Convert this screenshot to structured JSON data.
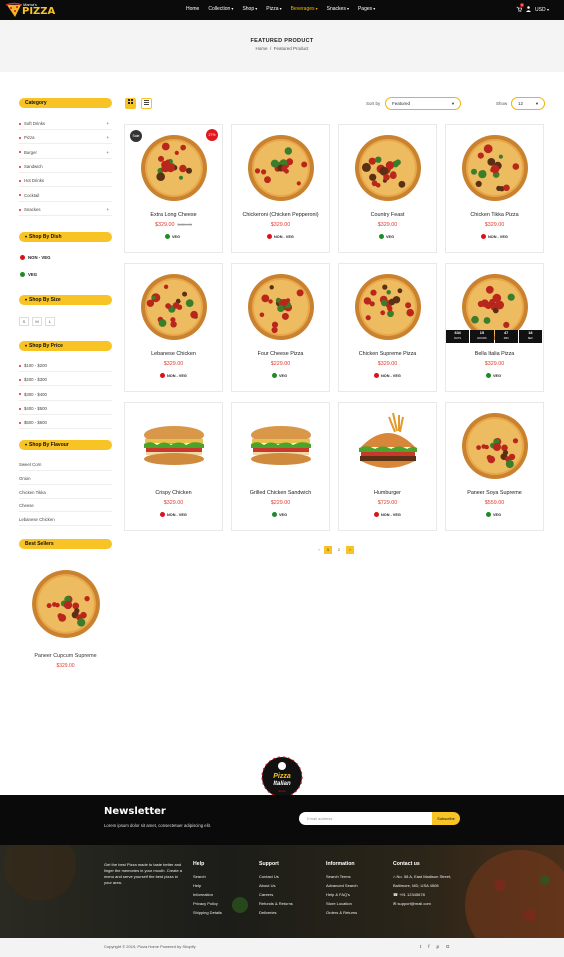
{
  "header": {
    "logo_top": "Mama's",
    "logo_main": "PIZZA",
    "nav": [
      {
        "label": "Home",
        "dd": false,
        "active": false
      },
      {
        "label": "Collection",
        "dd": true,
        "active": false
      },
      {
        "label": "Shop",
        "dd": true,
        "active": false
      },
      {
        "label": "Pizza",
        "dd": true,
        "active": false
      },
      {
        "label": "Beverages",
        "dd": true,
        "active": true
      },
      {
        "label": "Snackes",
        "dd": true,
        "active": false
      },
      {
        "label": "Pages",
        "dd": true,
        "active": false
      }
    ],
    "currency": "USD",
    "cart_count": "0"
  },
  "banner": {
    "title": "FEATURED PRODUCT",
    "crumb_home": "Home",
    "crumb_sep": "/",
    "crumb_current": "Featured Product"
  },
  "sidebar": {
    "category_title": "Category",
    "categories": [
      {
        "label": "Soft Drinks",
        "plus": true
      },
      {
        "label": "Pizza",
        "plus": true
      },
      {
        "label": "Burger",
        "plus": true
      },
      {
        "label": "Sandwich",
        "plus": false
      },
      {
        "label": "Hot Drinks",
        "plus": false
      },
      {
        "label": "Cocktail",
        "plus": false
      },
      {
        "label": "Snackes",
        "plus": true
      }
    ],
    "plus_symbol": "+",
    "dish_title": "Shop By Dish",
    "dish": [
      "NON - VEG",
      "VEG"
    ],
    "size_title": "Shop By Size",
    "sizes": [
      "S",
      "M",
      "L"
    ],
    "price_title": "Shop By Price",
    "prices": [
      "$100 - $200",
      "$200 - $300",
      "$300 - $400",
      "$400 - $500",
      "$500 - $600"
    ],
    "flavour_title": "Shop By Flavour",
    "flavours": [
      "Sweet Corn",
      "Onion",
      "Chicken Tikka",
      "Cheese",
      "Lebanese Chicken"
    ],
    "best_title": "Best Sellers",
    "best": {
      "name": "Paneer Cupcum Supreme",
      "price": "$329.00"
    }
  },
  "toolbar": {
    "sort_label": "Sort by",
    "sort_value": "Featured",
    "show_label": "Show",
    "show_value": "12"
  },
  "products": [
    {
      "name": "Extra Long Cheese",
      "price": "$329.00",
      "old": "$450.00",
      "tag": "VEG",
      "veg": true,
      "sale": "Sale",
      "pct": "27%",
      "kind": "pizza"
    },
    {
      "name": "Chickeroni (Chicken Pepperoni)",
      "price": "$329.00",
      "tag": "NON - VEG",
      "veg": false,
      "kind": "pizza"
    },
    {
      "name": "Country Feast",
      "price": "$329.00",
      "tag": "VEG",
      "veg": true,
      "kind": "pizza"
    },
    {
      "name": "Chicken Tikka Pizza",
      "price": "$329.00",
      "tag": "NON - VEG",
      "veg": false,
      "kind": "pizza"
    },
    {
      "name": "Lebanese Chicken",
      "price": "$329.00",
      "tag": "NON - VEG",
      "veg": false,
      "kind": "pizza"
    },
    {
      "name": "Four Cheese Pizza",
      "price": "$229.00",
      "tag": "VEG",
      "veg": true,
      "kind": "pizza"
    },
    {
      "name": "Chicken Supreme Pizza",
      "price": "$329.00",
      "tag": "NON - VEG",
      "veg": false,
      "kind": "pizza"
    },
    {
      "name": "Bella Italia Pizza",
      "price": "$329.00",
      "tag": "VEG",
      "veg": true,
      "kind": "pizza",
      "countdown": [
        {
          "v": "634",
          "l": "DAYS"
        },
        {
          "v": "15",
          "l": "HOURS"
        },
        {
          "v": "47",
          "l": "MIN"
        },
        {
          "v": "18",
          "l": "SEC"
        }
      ]
    },
    {
      "name": "Crispy Chicken",
      "price": "$329.00",
      "tag": "NON - VEG",
      "veg": false,
      "kind": "sandwich"
    },
    {
      "name": "Grilled Chicken Sandwich",
      "price": "$229.00",
      "tag": "VEG",
      "veg": true,
      "kind": "sandwich"
    },
    {
      "name": "Humburger",
      "price": "$729.00",
      "tag": "NON - VEG",
      "veg": false,
      "kind": "burger"
    },
    {
      "name": "Paneer Soya Supreme",
      "price": "$559.00",
      "tag": "VEG",
      "veg": true,
      "kind": "pizza"
    }
  ],
  "pagination": [
    "‹",
    "1",
    "2",
    "›"
  ],
  "footer": {
    "logo_word1": "Pizza",
    "logo_word2": "Italian",
    "logo_word3": "Since",
    "newsletter_title": "Newsletter",
    "newsletter_sub": "Lorem ipsum dolor sit amet, consectetuer adipiscing elit.",
    "email_placeholder": "Email address",
    "subscribe": "Subscribe",
    "about": "Get the best Pizza made to taste better and linger the memories in your mouth. Create a menu and serve yourself the best pizza in your area.",
    "cols": [
      {
        "h": "Help",
        "links": [
          "Search",
          "Help",
          "Information",
          "Privacy Policy",
          "Shipping Details"
        ]
      },
      {
        "h": "Support",
        "links": [
          "Contact Us",
          "About Us",
          "Careers",
          "Refunds & Returns",
          "Deliveries"
        ]
      },
      {
        "h": "Information",
        "links": [
          "Search Terms",
          "Advanced Search",
          "Help & FAQ's",
          "Store Location",
          "Orders & Returns"
        ]
      },
      {
        "h": "Contact us",
        "links": [
          "No. 58 A, East Madison Street,",
          "Baltimore, MD, USA 4508",
          "+91 12345678",
          "support@mail.com"
        ]
      }
    ],
    "copyright": "Copyright © 2019, Pizza Home Powered by Shopify",
    "social": [
      "t",
      "f",
      "p",
      "G"
    ]
  },
  "colors": {
    "accent": "#f7c325",
    "price": "#e0392b",
    "nonveg": "#d8141b",
    "veg": "#1d8b27"
  }
}
